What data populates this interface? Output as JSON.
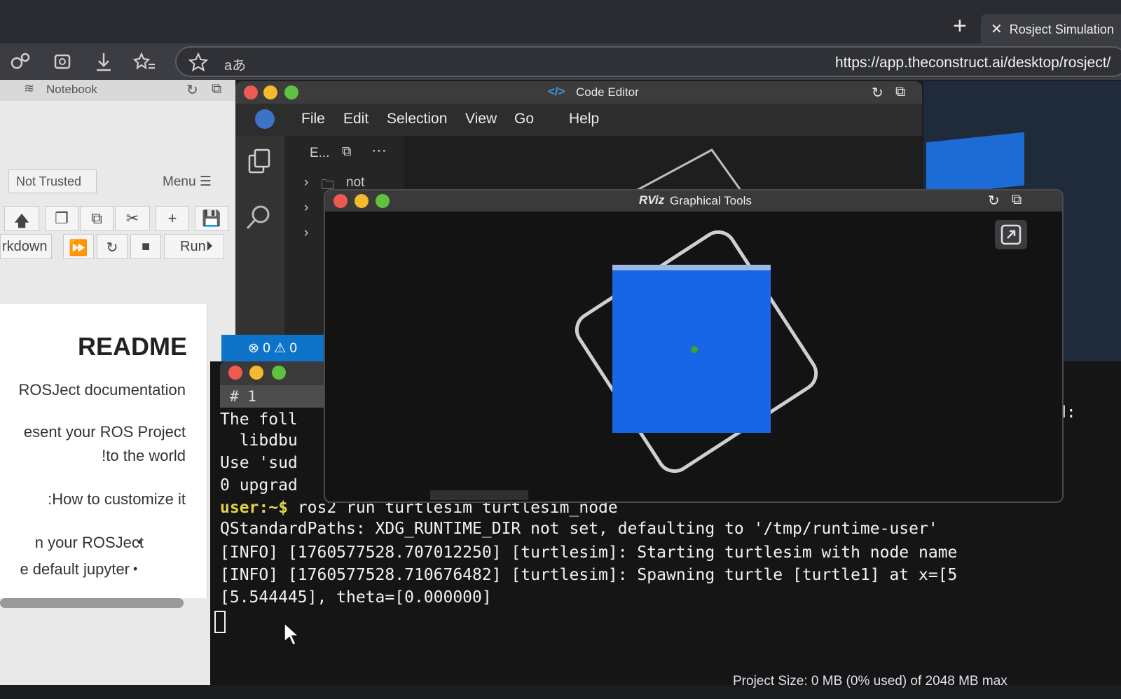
{
  "browser": {
    "tab_title": "Rosject Simulation",
    "new_tab_glyph": "+",
    "translate_glyph": "aあ",
    "url": "https://app.theconstruct.ai/desktop/rosject/"
  },
  "notebook": {
    "title": "Notebook",
    "trust_status": "Not Trusted",
    "menu_label": "Menu",
    "markdown_label": "rkdown",
    "run_label": "Run",
    "readme_heading": "README",
    "lines": [
      "ROSJect documentation",
      "esent your ROS Project",
      "!to the world",
      ":How to customize it",
      "n your ROSJect",
      "e default jupyter"
    ]
  },
  "code_editor": {
    "title": "Code Editor",
    "menu": [
      "File",
      "Edit",
      "Selection",
      "View",
      "Go",
      "Help"
    ],
    "explorer_label": "E...",
    "folder_name": "not",
    "errors": "0",
    "warnings": "0"
  },
  "rviz": {
    "logo": "RViz",
    "title": "Graphical Tools"
  },
  "terminal": {
    "tab_label": "# 1",
    "lines": [
      "The foll",
      "  libdbu",
      "Use 'sud",
      "0 upgrad"
    ],
    "prompt": "user:~$",
    "command": " ros2 run turtlesim turtlesim_node",
    "output": [
      "QStandardPaths: XDG_RUNTIME_DIR not set, defaulting to '/tmp/runtime-user'",
      "[INFO] [1760577528.707012250] [turtlesim]: Starting turtlesim with node name",
      "[INFO] [1760577528.710676482] [turtlesim]: Spawning turtle [turtle1] at x=[5",
      "[5.544445], theta=[0.000000]"
    ],
    "right_fragment": "d:"
  },
  "footer": {
    "project_size": "Project Size: 0 MB (0% used) of 2048 MB max"
  },
  "colors": {
    "accent": "#0e74c9",
    "prompt": "#e3d34a",
    "turtle_bg": "#1666e6",
    "traffic_red": "#ee5a52",
    "traffic_yellow": "#f4b92c",
    "traffic_green": "#5fc13f"
  }
}
